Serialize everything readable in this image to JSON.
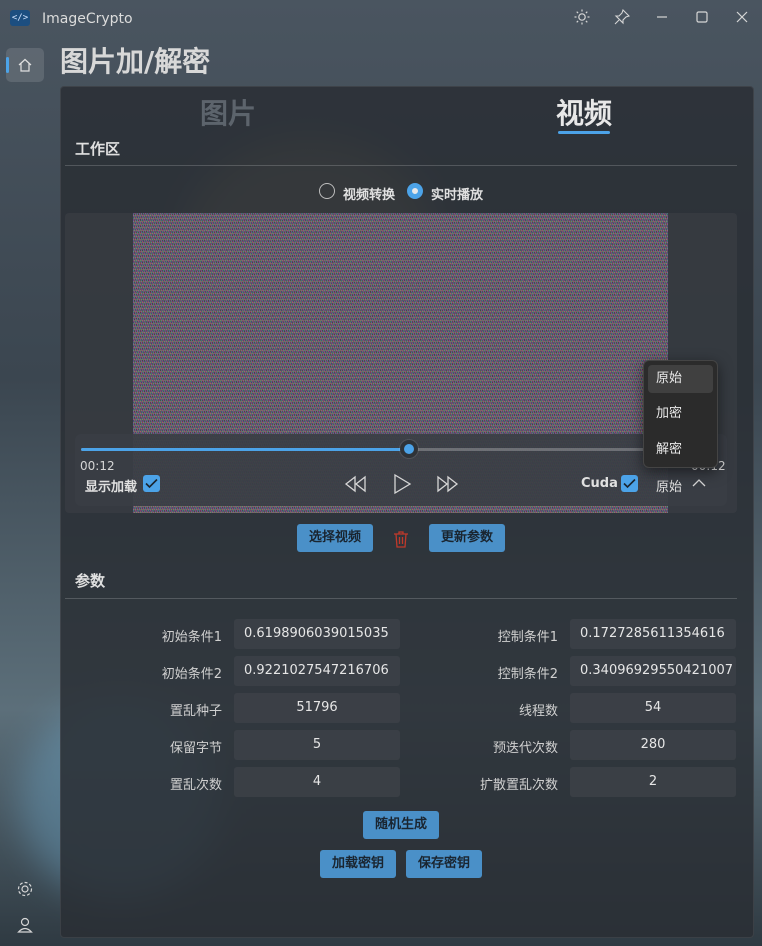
{
  "window": {
    "app_title": "ImageCrypto",
    "icons": [
      "app-logo-icon",
      "theme-sun-icon",
      "pin-icon",
      "minimize-icon",
      "maximize-icon",
      "close-icon"
    ]
  },
  "page": {
    "title": "图片加/解密"
  },
  "tabs": [
    {
      "label": "图片",
      "active": false
    },
    {
      "label": "视频",
      "active": true
    }
  ],
  "workspace": {
    "title": "工作区",
    "modes": [
      {
        "label": "视频转换",
        "checked": false
      },
      {
        "label": "实时播放",
        "checked": true
      }
    ],
    "player": {
      "current_time": "00:12",
      "total_time": "00:12",
      "progress": 0.58,
      "show_loading_label": "显示加载",
      "show_loading_checked": true,
      "cuda_label": "Cuda",
      "cuda_checked": true,
      "view_mode": "原始",
      "view_options": [
        "原始",
        "加密",
        "解密"
      ]
    },
    "buttons": {
      "select_video": "选择视频",
      "update_params": "更新参数"
    }
  },
  "params": {
    "title": "参数",
    "left": [
      {
        "label": "初始条件1",
        "value": "0.6198906039015035"
      },
      {
        "label": "初始条件2",
        "value": "0.9221027547216706"
      },
      {
        "label": "置乱种子",
        "value": "51796"
      },
      {
        "label": "保留字节",
        "value": "5"
      },
      {
        "label": "置乱次数",
        "value": "4"
      }
    ],
    "right": [
      {
        "label": "控制条件1",
        "value": "0.1727285611354616"
      },
      {
        "label": "控制条件2",
        "value": "0.34096929550421007"
      },
      {
        "label": "线程数",
        "value": "54"
      },
      {
        "label": "预迭代次数",
        "value": "280"
      },
      {
        "label": "扩散置乱次数",
        "value": "2"
      }
    ],
    "buttons": {
      "random": "随机生成",
      "load_key": "加载密钥",
      "save_key": "保存密钥"
    }
  },
  "colors": {
    "accent": "#4ca3e8",
    "button": "#4a90c8",
    "panel": "#2a2e34",
    "delete": "#c0392b"
  }
}
